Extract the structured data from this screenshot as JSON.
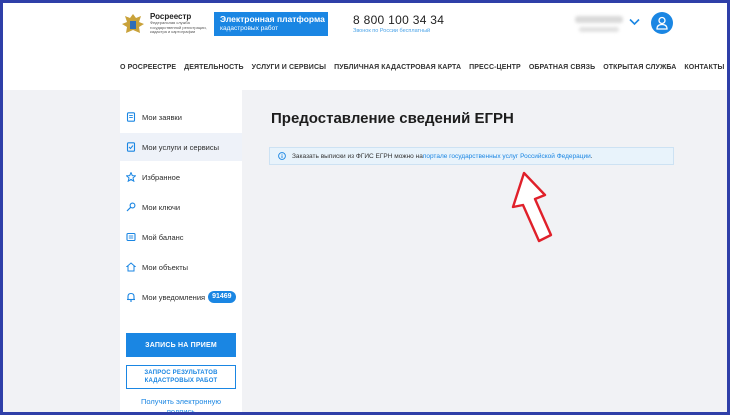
{
  "header": {
    "logo_title": "Росреестр",
    "logo_subtitle": "Федеральная служба государственной регистрации, кадастра и картографии",
    "platform_button": {
      "line1": "Электронная платформа",
      "line2": "кадастровых работ"
    },
    "phone": "8 800 100 34 34",
    "phone_note": "Звонок по России бесплатный"
  },
  "nav": {
    "items": [
      "О РОСРЕЕСТРЕ",
      "ДЕЯТЕЛЬНОСТЬ",
      "УСЛУГИ И СЕРВИСЫ",
      "ПУБЛИЧНАЯ КАДАСТРОВАЯ КАРТА",
      "ПРЕСС-ЦЕНТР",
      "ОБРАТНАЯ СВЯЗЬ",
      "ОТКРЫТАЯ СЛУЖБА",
      "КОНТАКТЫ"
    ]
  },
  "sidebar": {
    "items": [
      {
        "label": "Мои заявки",
        "icon": "document-icon"
      },
      {
        "label": "Мои услуги и сервисы",
        "icon": "services-icon"
      },
      {
        "label": "Избранное",
        "icon": "star-icon"
      },
      {
        "label": "Мои ключи",
        "icon": "key-icon"
      },
      {
        "label": "Мой баланс",
        "icon": "wallet-icon"
      },
      {
        "label": "Мои объекты",
        "icon": "house-icon"
      },
      {
        "label": "Мои уведомления",
        "icon": "bell-icon",
        "badge": "91469"
      }
    ],
    "primary_button": "ЗАПИСЬ НА ПРИЕМ",
    "outline_button": {
      "line1": "ЗАПРОС РЕЗУЛЬТАТОВ",
      "line2": "КАДАСТРОВЫХ РАБОТ"
    },
    "link": {
      "line1": "Получить электронную",
      "line2": "подпись"
    }
  },
  "main": {
    "title": "Предоставление сведений ЕГРН",
    "info": {
      "text": "Заказать выписки из ФГИС ЕГРН можно на ",
      "link": "портале государственных услуг Российской Федерации",
      "suffix": "."
    }
  },
  "colors": {
    "accent": "#1a86e3",
    "frame": "#2f3fa8",
    "arrow": "#e0202a",
    "content_bg": "#f1f2f5",
    "info_bg": "#e8f3fb"
  }
}
